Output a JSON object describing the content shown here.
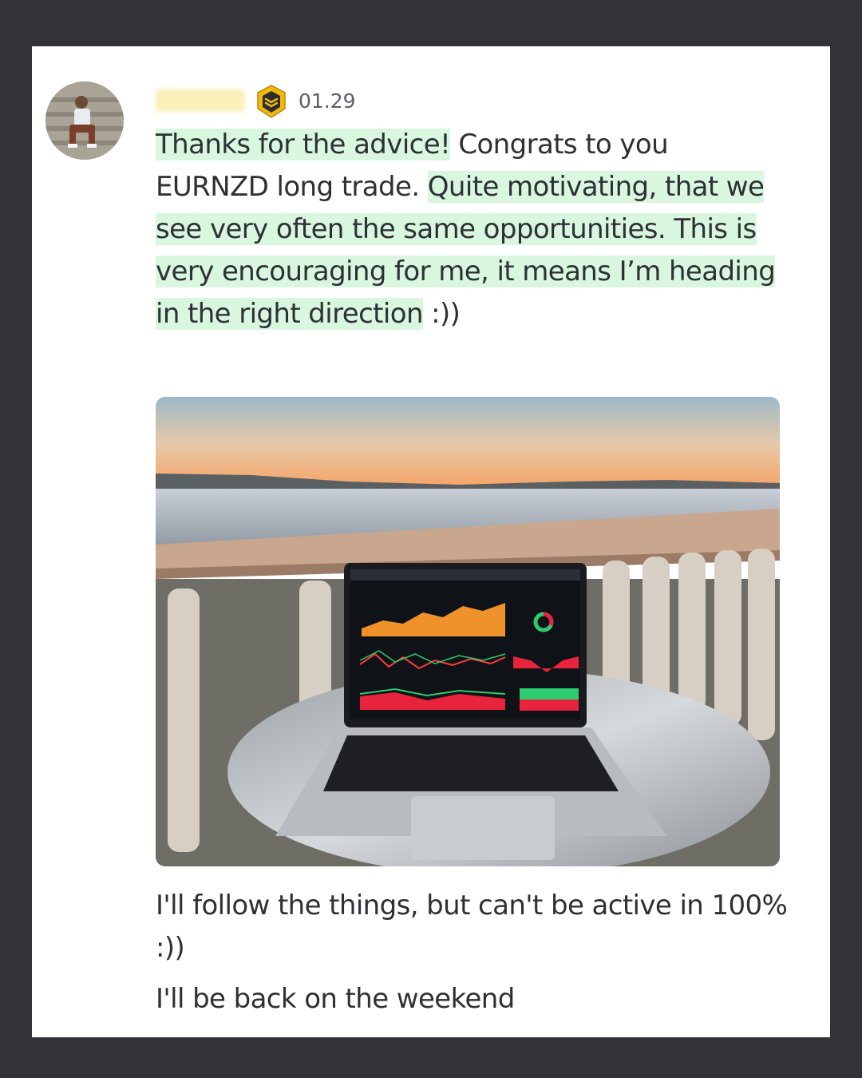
{
  "message": {
    "timestamp": "01.29",
    "badge_icon": "shield-badge-icon",
    "text_parts": [
      {
        "text": "Thanks for the advice!",
        "highlight": true
      },
      {
        "text": " Congrats to you EURNZD long trade. ",
        "highlight": false
      },
      {
        "text": "Quite motivating, that we see very often the same opportunities. This is very encouraging for me, it means I’m heading in the right direction",
        "highlight": true
      },
      {
        "text": " :))",
        "highlight": false
      }
    ],
    "followup_1": "I'll follow the things, but can't be active in 100% :))",
    "followup_2": "I'll be back on the weekend"
  },
  "colors": {
    "highlight": "#d9f7df",
    "background": "#313338",
    "card": "#ffffff",
    "badge": "#f0b90b"
  }
}
